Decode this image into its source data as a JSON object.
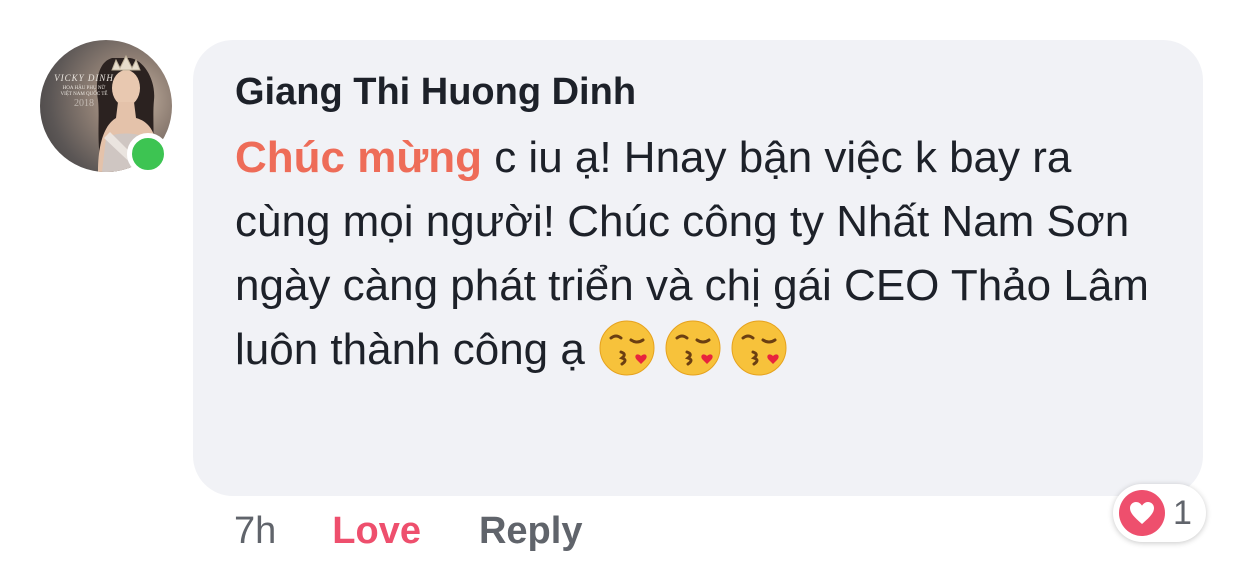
{
  "comment": {
    "author": "Giang Thi Huong Dinh",
    "highlight": "Chúc mừng",
    "text_line1": " c iu ạ! Hnay bận việc k bay ra cùng mọi người! Chúc công ty Nhất Nam Sơn ngày càng phát triển và chị gái CEO Thảo Lâm luôn thành công ạ",
    "emoji_name": "face-blowing-a-kiss-icon",
    "emoji_count": 3
  },
  "avatar": {
    "line1": "VICKY DINH",
    "line2": "HOA HẬU PHỤ NỮ",
    "line3": "VIỆT NAM QUỐC TẾ",
    "line4": "2018",
    "online": true
  },
  "actions": {
    "time": "7h",
    "love_label": "Love",
    "reply_label": "Reply"
  },
  "reactions": {
    "icon": "heart-icon",
    "count": "1"
  },
  "colors": {
    "bubble": "#f1f2f6",
    "highlight": "#ee6c58",
    "love": "#ee4f6d",
    "online": "#3dc452"
  }
}
